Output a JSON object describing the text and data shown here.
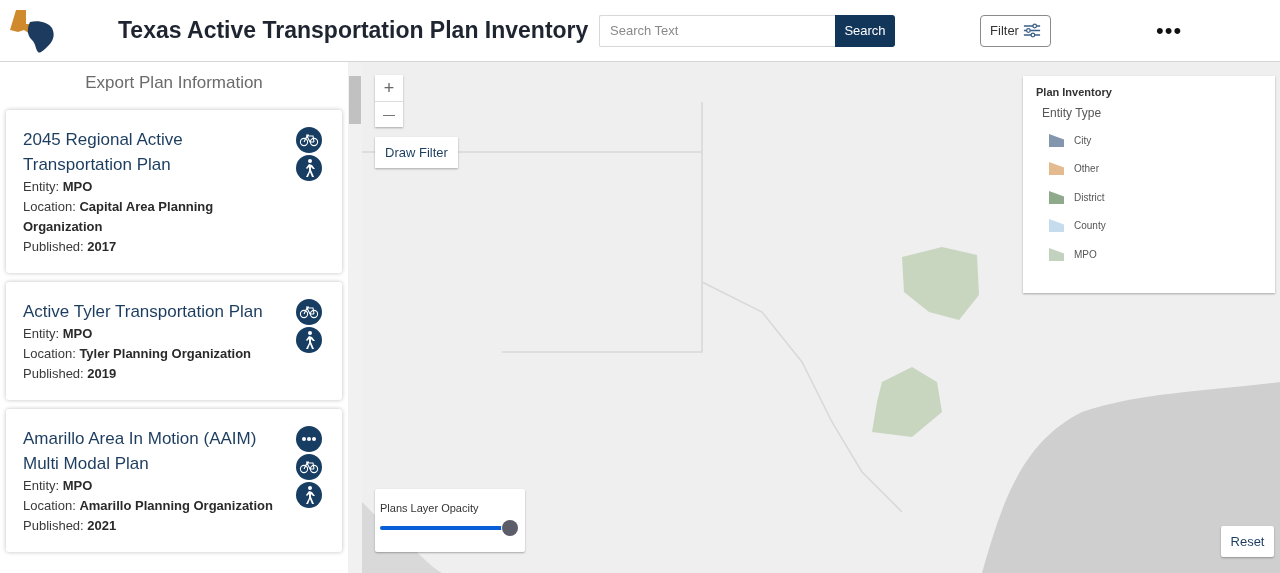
{
  "header": {
    "title": "Texas Active Transportation Plan Inventory",
    "search": {
      "placeholder": "Search Text",
      "button": "Search"
    },
    "filter_button": "Filter",
    "more_button": "•••"
  },
  "sidebar": {
    "heading": "Export Plan Information",
    "plans": [
      {
        "title": "2045 Regional Active Transportation Plan",
        "entity_label": "Entity:",
        "entity": "MPO",
        "location_label": "Location:",
        "location": "Capital Area Planning Organization",
        "published_label": "Published:",
        "published": "2017",
        "modes": [
          {
            "kind": "bike"
          },
          {
            "kind": "walk"
          }
        ]
      },
      {
        "title": "Active Tyler Transportation Plan",
        "entity_label": "Entity:",
        "entity": "MPO",
        "location_label": "Location:",
        "location": "Tyler Planning Organization",
        "published_label": "Published:",
        "published": "2019",
        "modes": [
          {
            "kind": "bike"
          },
          {
            "kind": "walk"
          }
        ]
      },
      {
        "title": "Amarillo Area In Motion (AAIM) Multi Modal Plan",
        "entity_label": "Entity:",
        "entity": "MPO",
        "location_label": "Location:",
        "location": "Amarillo Planning Organization",
        "published_label": "Published:",
        "published": "2021",
        "modes": [
          {
            "kind": "other"
          },
          {
            "kind": "bike"
          },
          {
            "kind": "walk"
          }
        ]
      }
    ]
  },
  "map": {
    "zoom_in": "+",
    "zoom_out": "—",
    "draw_filter": "Draw Filter",
    "reset": "Reset",
    "legend": {
      "title": "Plan Inventory",
      "subtitle": "Entity Type",
      "items": [
        {
          "label": "City",
          "color": "#8496ad"
        },
        {
          "label": "Other",
          "color": "#e3bb8e"
        },
        {
          "label": "District",
          "color": "#8eaa8a"
        },
        {
          "label": "County",
          "color": "#c5dcee"
        },
        {
          "label": "MPO",
          "color": "#c3d2be"
        }
      ]
    },
    "opacity": {
      "label": "Plans Layer Opacity",
      "level": 1
    }
  }
}
